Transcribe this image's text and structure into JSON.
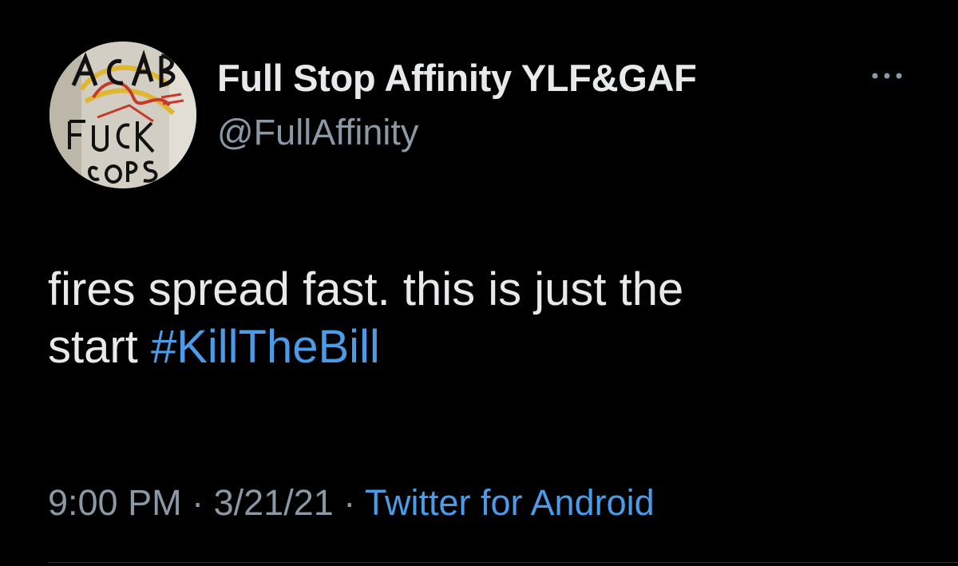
{
  "tweet": {
    "author": {
      "display_name": "Full Stop Affinity YLF&GAF",
      "handle": "@FullAffinity",
      "avatar_icon": "graffiti-avatar",
      "avatar_lettering": [
        "ACAB",
        "FUCK",
        "COPS"
      ]
    },
    "more_icon": "more-options-icon",
    "text_line1": "fires spread fast. this is just the",
    "text_line2_prefix": "start",
    "hashtag": "#KillTheBill",
    "time": "9:00 PM",
    "separator": "·",
    "date": "3/21/21",
    "source": "Twitter for Android"
  },
  "colors": {
    "background": "#000000",
    "primary_text": "#e7e9ea",
    "secondary_text": "#8b98a5",
    "link": "#4a9be8"
  }
}
